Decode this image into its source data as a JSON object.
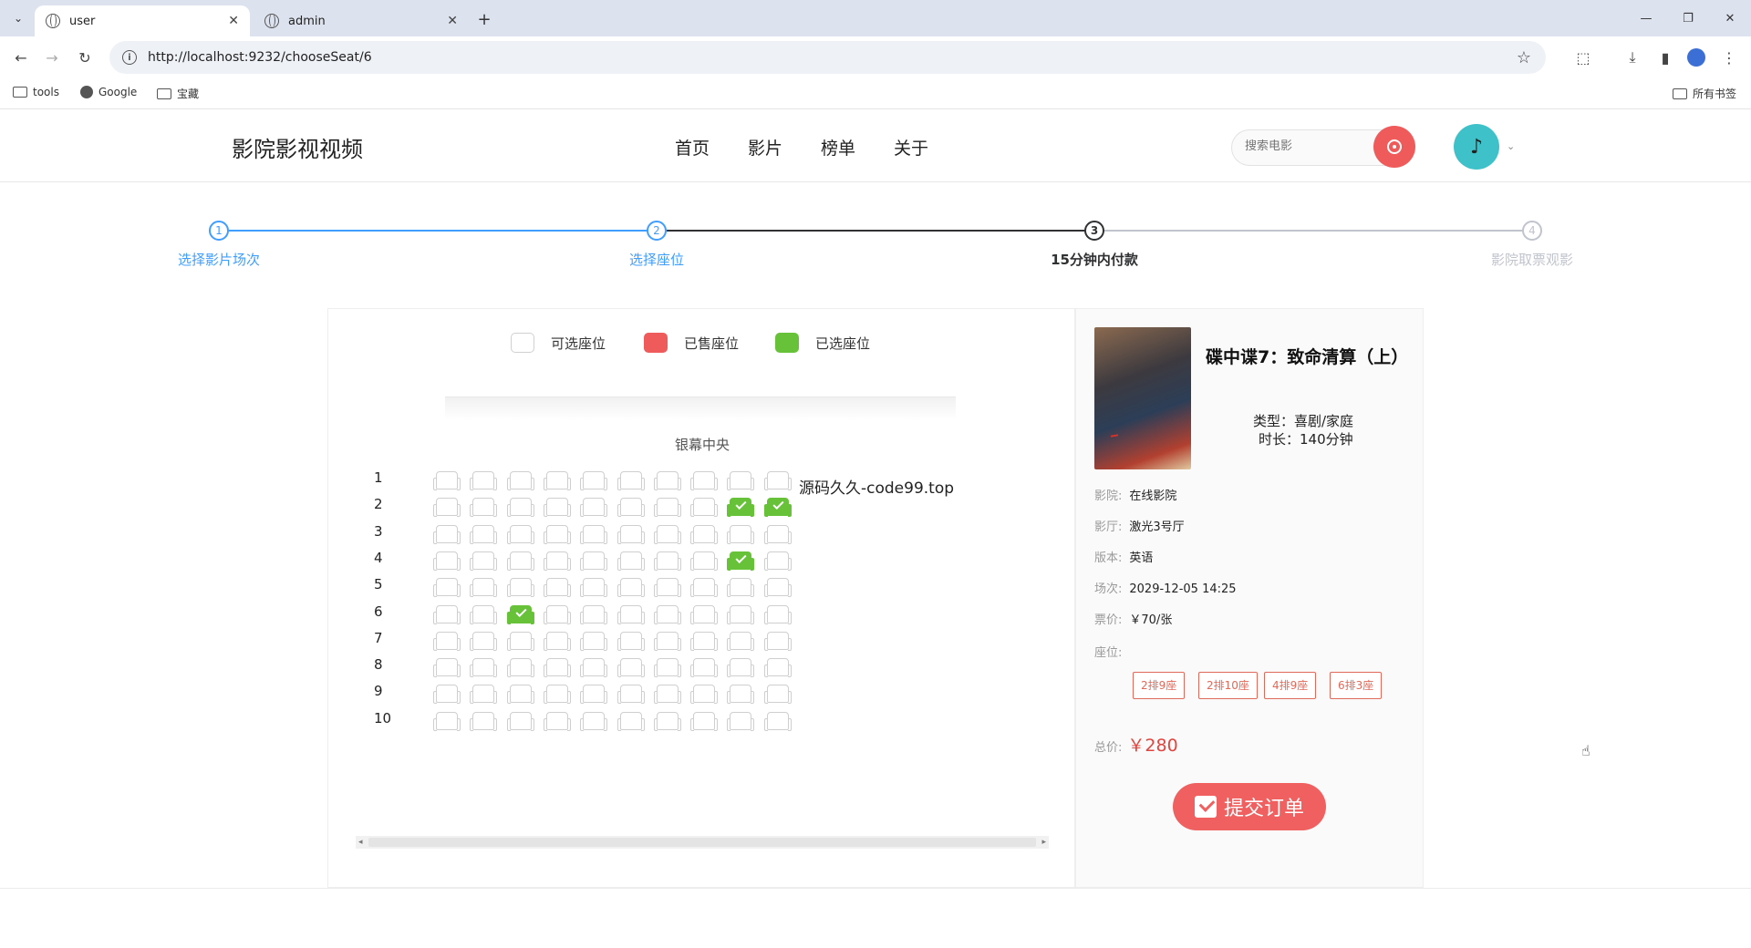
{
  "browser": {
    "tabs": [
      {
        "title": "user",
        "active": true
      },
      {
        "title": "admin",
        "active": false
      }
    ],
    "url": "http://localhost:9232/chooseSeat/6",
    "bookmarks": [
      "tools",
      "Google",
      "宝藏"
    ],
    "all_bookmarks_label": "所有书签"
  },
  "site": {
    "logo": "影院影视视频",
    "nav": [
      "首页",
      "影片",
      "榜单",
      "关于"
    ],
    "search_placeholder": "搜索电影"
  },
  "steps": [
    {
      "num": "1",
      "label": "选择影片场次",
      "state": "done"
    },
    {
      "num": "2",
      "label": "选择座位",
      "state": "done"
    },
    {
      "num": "3",
      "label": "15分钟内付款",
      "state": "active"
    },
    {
      "num": "4",
      "label": "影院取票观影",
      "state": "wait"
    }
  ],
  "legend": {
    "available": "可选座位",
    "sold": "已售座位",
    "selected": "已选座位",
    "colors": {
      "sold": "#ef5a5a",
      "selected": "#67c23a"
    }
  },
  "screen_label": "银幕中央",
  "promo_text": "源码久久-code99.top",
  "seat_map": {
    "rows": [
      "1",
      "2",
      "3",
      "4",
      "5",
      "6",
      "7",
      "8",
      "9",
      "10"
    ],
    "columns": 10,
    "selected": [
      [
        2,
        9
      ],
      [
        2,
        10
      ],
      [
        4,
        9
      ],
      [
        6,
        3
      ]
    ]
  },
  "movie": {
    "title": "碟中谍7：致命清算（上）",
    "genre": "类型：喜剧/家庭",
    "duration": "时长：140分钟",
    "details": [
      {
        "key": "影院:",
        "value": "在线影院"
      },
      {
        "key": "影厅:",
        "value": "激光3号厅"
      },
      {
        "key": "版本:",
        "value": "英语"
      },
      {
        "key": "场次:",
        "value": "2029-12-05 14:25"
      },
      {
        "key": "票价:",
        "value": "￥70/张"
      }
    ],
    "seats_label": "座位:",
    "tickets": [
      "2排9座",
      "2排10座",
      "4排9座",
      "6排3座"
    ],
    "total_label": "总价:",
    "total_value": "￥280",
    "submit_label": "提交订单"
  }
}
